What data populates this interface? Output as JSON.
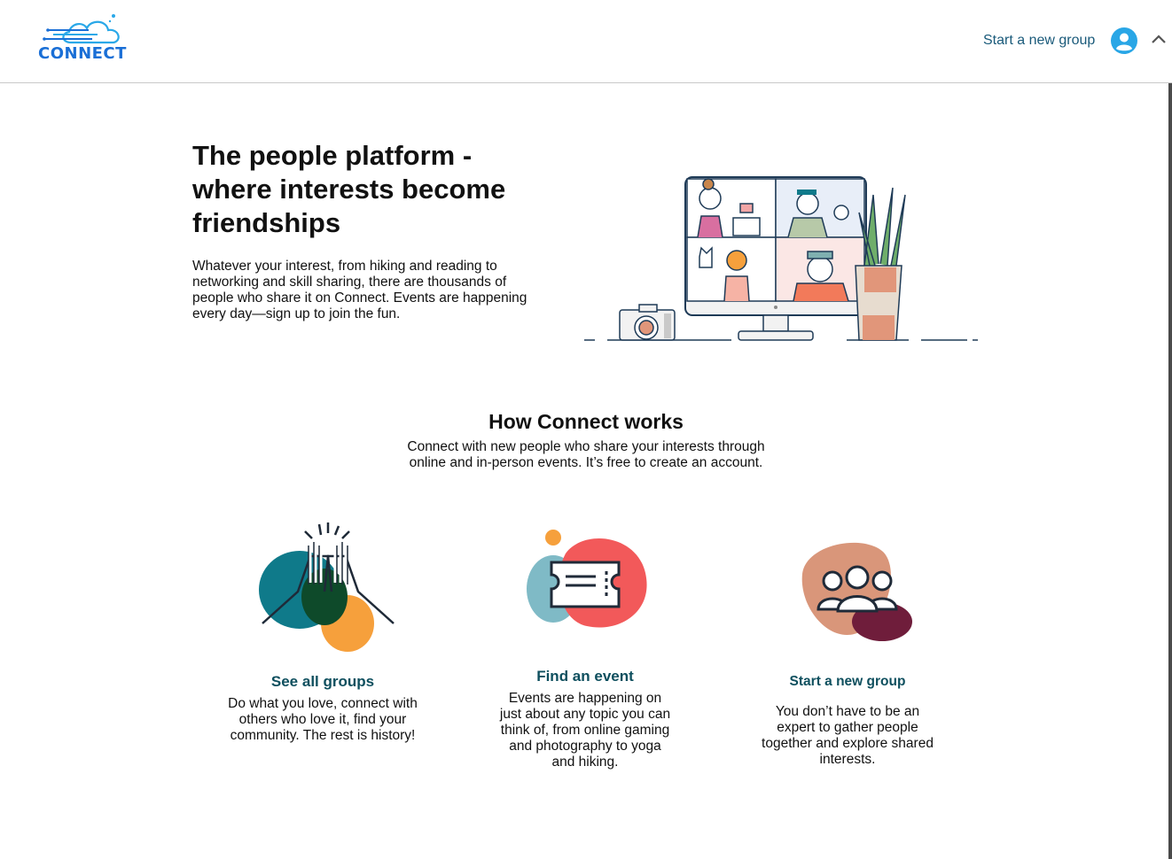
{
  "header": {
    "logo_text": "CONNECT",
    "nav_link": "Start a new group",
    "brand_color": "#1a6fd6",
    "icons": [
      "user-avatar-icon",
      "chevron-up-icon"
    ]
  },
  "hero": {
    "title": "The people platform - where interests become friendships",
    "text": "Whatever your interest, from hiking and reading to networking and skill sharing, there are thousands of people who share it on Connect. Events are happening every day—sign up to join the fun."
  },
  "how": {
    "title": "How Connect works",
    "subtitle": "Connect with new people who share your interests through online and in-person events. It’s free to create an account."
  },
  "features": [
    {
      "title": "See all groups",
      "text": "Do what you love, connect with others who love it, find your community. The rest is history!",
      "icon": "high-five-icon"
    },
    {
      "title": "Find an event",
      "text": "Events are happening on just about any topic you can think of, from online gaming and photography to yoga and hiking.",
      "icon": "ticket-icon"
    },
    {
      "title": "Start a new group",
      "text": "You don’t have to be an expert to gather people together and explore shared interests.",
      "icon": "people-group-icon"
    }
  ],
  "colors": {
    "feature_title": "#0e4f5e",
    "teal": "#0f7a8a",
    "orange": "#f6a03c",
    "coral": "#f2595a",
    "rose": "#d9967a",
    "maroon": "#6f1d3b"
  }
}
